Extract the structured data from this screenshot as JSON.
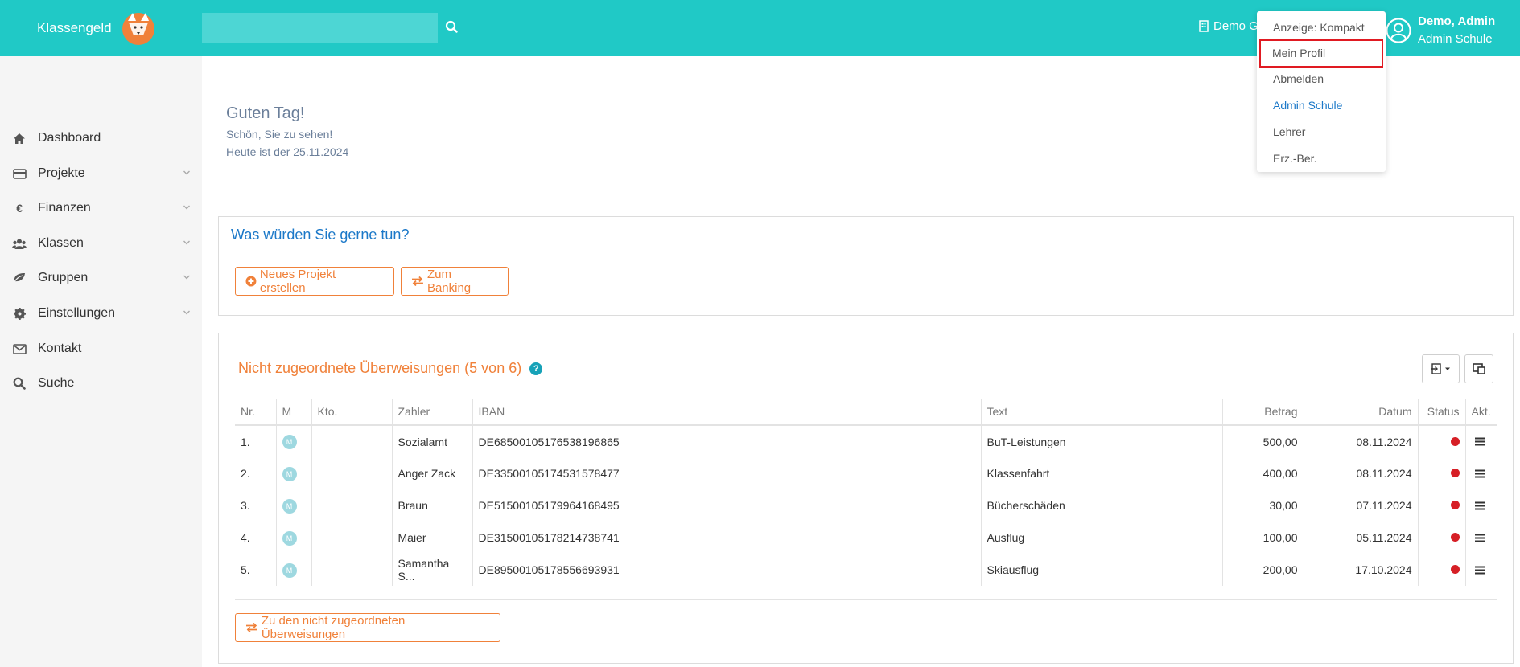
{
  "header": {
    "brand": "Klassengeld",
    "search_placeholder": "",
    "school_link": "Demo G",
    "user_name": "Demo, Admin",
    "user_role": "Admin Schule",
    "bar_color": "#20c9c6"
  },
  "dropdown": {
    "items": [
      {
        "label": "Anzeige: Kompakt"
      },
      {
        "label": "Mein Profil"
      },
      {
        "label": "Abmelden"
      },
      {
        "label": "Admin Schule"
      },
      {
        "label": "Lehrer"
      },
      {
        "label": "Erz.-Ber."
      }
    ]
  },
  "sidebar": {
    "items": [
      {
        "label": "Dashboard",
        "icon": "home-icon"
      },
      {
        "label": "Projekte",
        "icon": "credit-card-icon"
      },
      {
        "label": "Finanzen",
        "icon": "euro-icon"
      },
      {
        "label": "Klassen",
        "icon": "users-icon"
      },
      {
        "label": "Gruppen",
        "icon": "leaf-icon"
      },
      {
        "label": "Einstellungen",
        "icon": "gear-icon"
      },
      {
        "label": "Kontakt",
        "icon": "envelope-icon"
      },
      {
        "label": "Suche",
        "icon": "search-icon"
      }
    ]
  },
  "greeting": {
    "title": "Guten Tag!",
    "line1": "Schön, Sie zu sehen!",
    "line2": "Heute ist der 25.11.2024"
  },
  "actions": {
    "title": "Was würden Sie gerne tun?",
    "new_project": "Neues Projekt erstellen",
    "banking": "Zum Banking"
  },
  "transfers": {
    "title": "Nicht zugeordnete Überweisungen (5 von 6)",
    "columns": [
      "Nr.",
      "M",
      "Kto.",
      "Zahler",
      "IBAN",
      "Text",
      "Betrag",
      "Datum",
      "Status",
      "Akt."
    ],
    "rows": [
      {
        "nr": "1.",
        "m": "M",
        "kto": "",
        "zahler": "Sozialamt",
        "iban": "DE68500105176538196865",
        "text": "BuT-Leistungen",
        "betrag": "500,00",
        "datum": "08.11.2024"
      },
      {
        "nr": "2.",
        "m": "M",
        "kto": "",
        "zahler": "Anger Zack",
        "iban": "DE33500105174531578477",
        "text": "Klassenfahrt",
        "betrag": "400,00",
        "datum": "08.11.2024"
      },
      {
        "nr": "3.",
        "m": "M",
        "kto": "",
        "zahler": "Braun",
        "iban": "DE51500105179964168495",
        "text": "Bücherschäden",
        "betrag": "30,00",
        "datum": "07.11.2024"
      },
      {
        "nr": "4.",
        "m": "M",
        "kto": "",
        "zahler": "Maier",
        "iban": "DE31500105178214738741",
        "text": "Ausflug",
        "betrag": "100,00",
        "datum": "05.11.2024"
      },
      {
        "nr": "5.",
        "m": "M",
        "kto": "",
        "zahler": "Samantha S...",
        "iban": "DE89500105178556693931",
        "text": "Skiausflug",
        "betrag": "200,00",
        "datum": "17.10.2024"
      }
    ],
    "status_color": "#d61f26",
    "goto_button": "Zu den nicht zugeordneten Überweisungen"
  }
}
